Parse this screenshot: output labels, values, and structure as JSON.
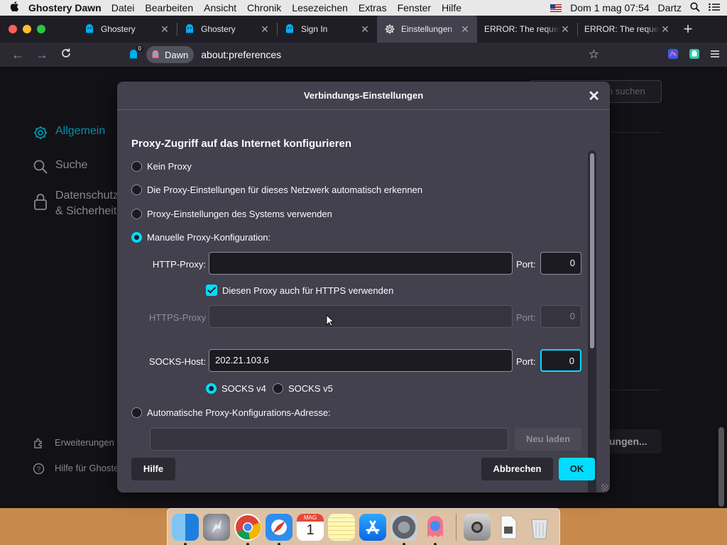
{
  "menubar": {
    "apple": "",
    "app_name": "Ghostery Dawn",
    "items": [
      "Datei",
      "Bearbeiten",
      "Ansicht",
      "Chronik",
      "Lesezeichen",
      "Extras",
      "Fenster",
      "Hilfe"
    ],
    "clock": "Dom 1 mag  07:54",
    "user": "Dartz"
  },
  "tabs": [
    {
      "label": "Ghostery",
      "icon": "ghostery-icon"
    },
    {
      "label": "Ghostery",
      "icon": "ghostery-icon"
    },
    {
      "label": "Sign In",
      "icon": "ghostery-icon"
    },
    {
      "label": "Einstellungen",
      "icon": "gear-icon",
      "active": true
    },
    {
      "label": "ERROR: The request",
      "icon": "none"
    },
    {
      "label": "ERROR: The request",
      "icon": "none"
    }
  ],
  "toolbar": {
    "identity_label": "Dawn",
    "url": "about:preferences",
    "tracker_count": "0"
  },
  "sidebar": {
    "items": [
      {
        "label": "Allgemein",
        "icon": "gear-icon"
      },
      {
        "label": "Suche",
        "icon": "search-icon"
      },
      {
        "label": "Datenschutz & Sicherheit",
        "icon": "lock-icon"
      }
    ],
    "footer": [
      {
        "label": "Erweiterungen & Themes",
        "icon": "puzzle-icon"
      },
      {
        "label": "Hilfe für Ghostery Dawn",
        "icon": "help-icon"
      }
    ]
  },
  "background": {
    "search_placeholder": "n suchen",
    "settings_button": "ungen..."
  },
  "dialog": {
    "title": "Verbindungs-Einstellungen",
    "heading": "Proxy-Zugriff auf das Internet konfigurieren",
    "options": [
      {
        "label": "Kein Proxy",
        "selected": false
      },
      {
        "label": "Die Proxy-Einstellungen für dieses Netzwerk automatisch erkennen",
        "selected": false
      },
      {
        "label": "Proxy-Einstellungen des Systems verwenden",
        "selected": false
      },
      {
        "label": "Manuelle Proxy-Konfiguration:",
        "selected": true
      }
    ],
    "http_proxy_label": "HTTP-Proxy:",
    "http_proxy_value": "",
    "port_label": "Port:",
    "http_port": "0",
    "https_checkbox_label": "Diesen Proxy auch für HTTPS verwenden",
    "https_checked": true,
    "https_proxy_label": "HTTPS-Proxy",
    "https_proxy_value": "",
    "https_port": "0",
    "socks_host_label": "SOCKS-Host:",
    "socks_host_value": "202.21.103.6",
    "socks_port": "0",
    "socks_v4_label": "SOCKS v4",
    "socks_v5_label": "SOCKS v5",
    "socks_version_selected": "SOCKS v4",
    "auto_config_label": "Automatische Proxy-Konfigurations-Adresse:",
    "auto_config_value": "",
    "reload_label": "Neu laden",
    "help_label": "Hilfe",
    "cancel_label": "Abbrechen",
    "ok_label": "OK"
  },
  "dock": {
    "apps": [
      "finder-icon",
      "launchpad-icon",
      "chrome-icon",
      "safari-icon",
      "calendar-icon",
      "notes-icon",
      "app-store-icon",
      "system-preferences-icon",
      "ghostery-dawn-icon",
      "preview-icon",
      "document-icon",
      "trash-icon"
    ],
    "calendar_month": "MAG",
    "calendar_day": "1"
  },
  "colors": {
    "accent": "#00ddff",
    "dialog_bg": "#42414d",
    "page_bg": "#1c1b22"
  }
}
